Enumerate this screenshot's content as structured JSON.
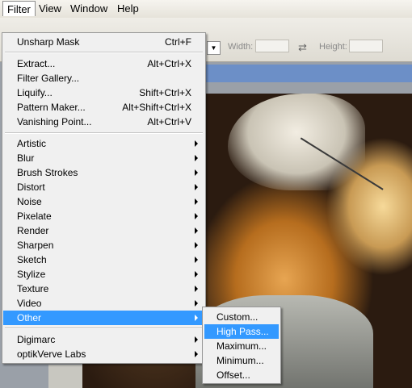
{
  "menubar": {
    "items": [
      "Filter",
      "View",
      "Window",
      "Help"
    ],
    "active": "Filter"
  },
  "options_bar": {
    "width_label": "Width:",
    "height_label": "Height:"
  },
  "filter_menu": {
    "items": [
      {
        "label": "Unsharp Mask",
        "shortcut": "Ctrl+F"
      },
      {
        "label": "Extract...",
        "shortcut": "Alt+Ctrl+X"
      },
      {
        "label": "Filter Gallery...",
        "shortcut": ""
      },
      {
        "label": "Liquify...",
        "shortcut": "Shift+Ctrl+X"
      },
      {
        "label": "Pattern Maker...",
        "shortcut": "Alt+Shift+Ctrl+X"
      },
      {
        "label": "Vanishing Point...",
        "shortcut": "Alt+Ctrl+V"
      },
      {
        "label": "Artistic",
        "submenu": true
      },
      {
        "label": "Blur",
        "submenu": true
      },
      {
        "label": "Brush Strokes",
        "submenu": true
      },
      {
        "label": "Distort",
        "submenu": true
      },
      {
        "label": "Noise",
        "submenu": true
      },
      {
        "label": "Pixelate",
        "submenu": true
      },
      {
        "label": "Render",
        "submenu": true
      },
      {
        "label": "Sharpen",
        "submenu": true
      },
      {
        "label": "Sketch",
        "submenu": true
      },
      {
        "label": "Stylize",
        "submenu": true
      },
      {
        "label": "Texture",
        "submenu": true
      },
      {
        "label": "Video",
        "submenu": true
      },
      {
        "label": "Other",
        "submenu": true,
        "highlighted": true
      },
      {
        "label": "Digimarc",
        "submenu": true
      },
      {
        "label": "optikVerve Labs",
        "submenu": true
      }
    ]
  },
  "other_submenu": {
    "items": [
      {
        "label": "Custom..."
      },
      {
        "label": "High Pass...",
        "highlighted": true
      },
      {
        "label": "Maximum..."
      },
      {
        "label": "Minimum..."
      },
      {
        "label": "Offset..."
      }
    ]
  },
  "colors": {
    "highlight": "#3399ff",
    "menu_bg": "#f0f0f0"
  }
}
